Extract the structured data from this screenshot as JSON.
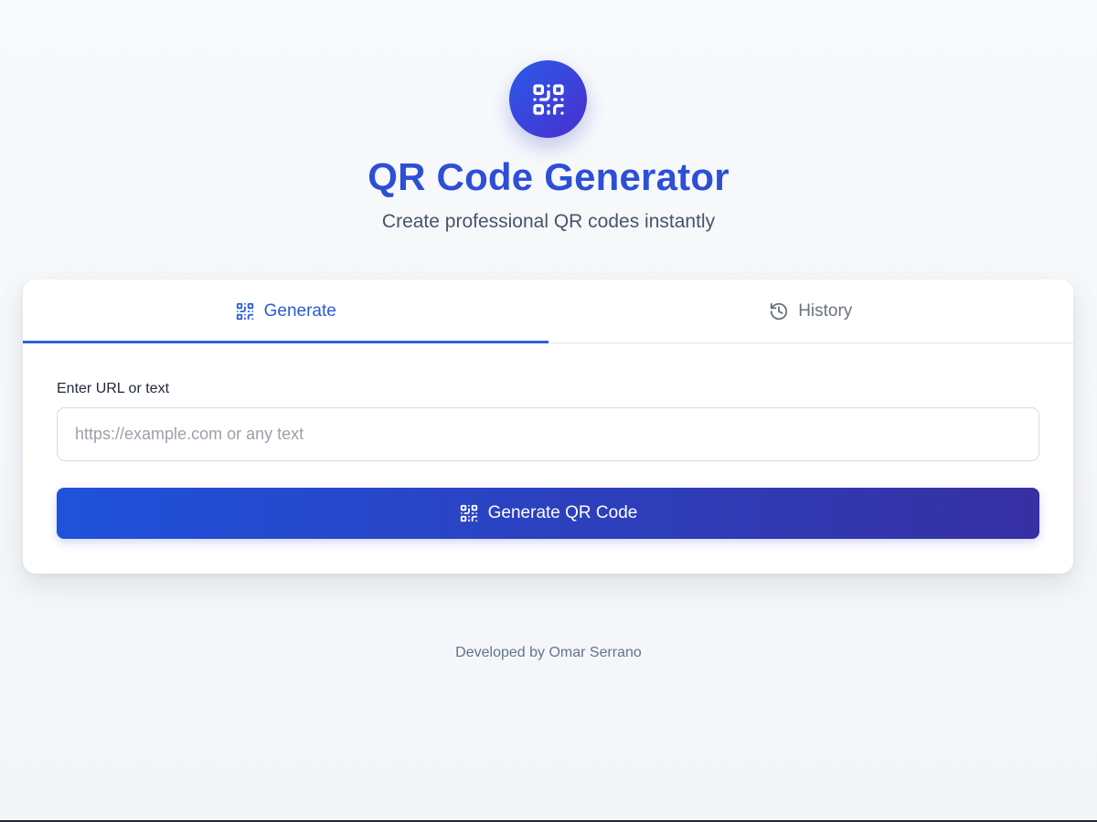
{
  "header": {
    "logo_icon": "qr-code-icon",
    "title": "QR Code Generator",
    "subtitle": "Create professional QR codes instantly"
  },
  "tabs": [
    {
      "label": "Generate",
      "icon": "qr-code-icon",
      "active": true
    },
    {
      "label": "History",
      "icon": "history-icon",
      "active": false
    }
  ],
  "form": {
    "label": "Enter URL or text",
    "input_value": "",
    "input_placeholder": "https://example.com or any text",
    "button_label": "Generate QR Code",
    "button_icon": "qr-code-icon"
  },
  "footer": {
    "text": "Developed by Omar Serrano"
  },
  "colors": {
    "primary": "#2c4fd6",
    "gradient_start": "#1f52db",
    "gradient_end": "#3730a3",
    "active_tab": "#2a5bd7",
    "inactive_tab": "#6b7280"
  }
}
